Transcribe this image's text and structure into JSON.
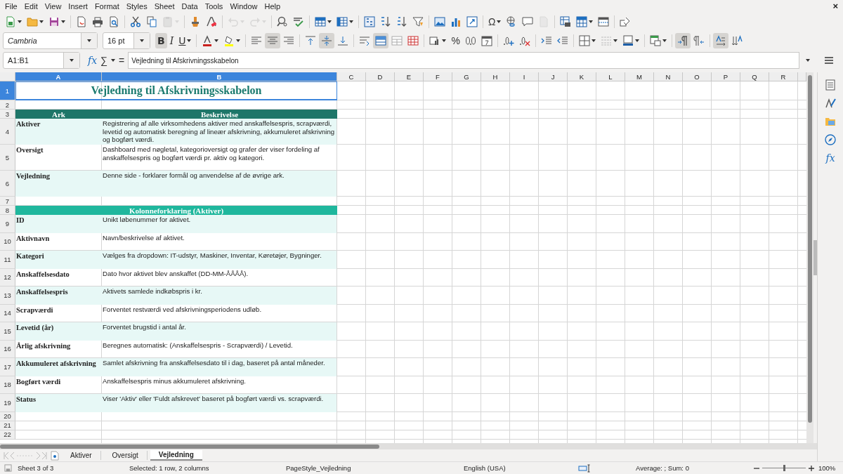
{
  "menu": [
    "File",
    "Edit",
    "View",
    "Insert",
    "Format",
    "Styles",
    "Sheet",
    "Data",
    "Tools",
    "Window",
    "Help"
  ],
  "close_label": "×",
  "standard_buttons": [
    {
      "kind": "new",
      "disabled": false
    },
    {
      "kind": "open",
      "disabled": false
    },
    {
      "kind": "save",
      "disabled": false
    },
    {
      "kind": "sep"
    },
    {
      "kind": "pdf",
      "disabled": false
    },
    {
      "kind": "print",
      "disabled": false
    },
    {
      "kind": "preview",
      "disabled": false
    },
    {
      "kind": "sep"
    },
    {
      "kind": "cut",
      "disabled": false
    },
    {
      "kind": "copy",
      "disabled": false
    },
    {
      "kind": "paste",
      "disabled": true
    },
    {
      "kind": "sep"
    },
    {
      "kind": "clone",
      "disabled": false
    },
    {
      "kind": "clear",
      "disabled": false
    },
    {
      "kind": "sep"
    },
    {
      "kind": "undo",
      "disabled": true
    },
    {
      "kind": "redo",
      "disabled": true
    },
    {
      "kind": "sep"
    },
    {
      "kind": "find",
      "disabled": false
    },
    {
      "kind": "spell",
      "disabled": false
    },
    {
      "kind": "sep"
    },
    {
      "kind": "row",
      "disabled": false
    },
    {
      "kind": "column",
      "disabled": false
    },
    {
      "kind": "sep"
    },
    {
      "kind": "sort",
      "disabled": false
    },
    {
      "kind": "sort_asc",
      "disabled": false
    },
    {
      "kind": "sort_desc",
      "disabled": false
    },
    {
      "kind": "filter",
      "disabled": false
    },
    {
      "kind": "sep"
    },
    {
      "kind": "image",
      "disabled": false
    },
    {
      "kind": "chart",
      "disabled": false
    },
    {
      "kind": "pivot",
      "disabled": false
    },
    {
      "kind": "sep"
    },
    {
      "kind": "special",
      "label": "Ω",
      "disabled": false
    },
    {
      "kind": "link",
      "disabled": false
    },
    {
      "kind": "comment",
      "disabled": false
    },
    {
      "kind": "headerfooter",
      "disabled": true
    },
    {
      "kind": "sep"
    },
    {
      "kind": "printarea",
      "disabled": false
    },
    {
      "kind": "freeze",
      "disabled": false
    },
    {
      "kind": "split",
      "disabled": false
    },
    {
      "kind": "sep"
    },
    {
      "kind": "draw",
      "disabled": false
    }
  ],
  "font_name": "Cambria",
  "font_size": "16 pt",
  "format_buttons": [
    {
      "kind": "bold",
      "label": "B",
      "selected": true
    },
    {
      "kind": "italic",
      "label": "I",
      "selected": false
    },
    {
      "kind": "underline",
      "label": "U",
      "selected": false
    },
    {
      "kind": "sep"
    },
    {
      "kind": "font_color",
      "selected": false
    },
    {
      "kind": "highlight",
      "selected": false
    },
    {
      "kind": "sep"
    },
    {
      "kind": "align_left",
      "selected": false
    },
    {
      "kind": "align_center",
      "selected": true
    },
    {
      "kind": "align_right",
      "selected": false
    },
    {
      "kind": "sep"
    },
    {
      "kind": "align_top",
      "selected": false
    },
    {
      "kind": "align_middle",
      "selected": true
    },
    {
      "kind": "align_bottom",
      "selected": false
    },
    {
      "kind": "sep"
    },
    {
      "kind": "wrap",
      "selected": false
    },
    {
      "kind": "merge_center",
      "selected": true
    },
    {
      "kind": "merge",
      "selected": false
    },
    {
      "kind": "unmerge",
      "selected": false
    },
    {
      "kind": "sep"
    },
    {
      "kind": "currency",
      "selected": false
    },
    {
      "kind": "percent",
      "label": "%",
      "selected": false
    },
    {
      "kind": "number",
      "selected": false
    },
    {
      "kind": "date",
      "selected": false
    },
    {
      "kind": "sep"
    },
    {
      "kind": "add_decimal",
      "selected": false
    },
    {
      "kind": "delete_decimal",
      "selected": false
    },
    {
      "kind": "sep"
    },
    {
      "kind": "indent_more",
      "selected": false
    },
    {
      "kind": "indent_less",
      "selected": false
    },
    {
      "kind": "sep"
    },
    {
      "kind": "borders",
      "selected": false
    },
    {
      "kind": "border_style",
      "selected": false
    },
    {
      "kind": "border_color",
      "selected": false
    },
    {
      "kind": "sep"
    },
    {
      "kind": "conditional",
      "selected": false
    },
    {
      "kind": "sep"
    },
    {
      "kind": "ltr",
      "selected": true
    },
    {
      "kind": "rtl",
      "selected": false
    },
    {
      "kind": "sep"
    },
    {
      "kind": "text_ltr",
      "selected": true
    },
    {
      "kind": "text_ttb",
      "selected": false
    }
  ],
  "formula_bar": {
    "name_box": "A1:B1",
    "wizard_label": "fx",
    "sum_label": "∑",
    "equals_label": "=",
    "content": "Vejledning til Afskrivningsskabelon"
  },
  "columns": [
    {
      "label": "A",
      "selected": true
    },
    {
      "label": "B",
      "selected": true
    },
    {
      "label": "C",
      "selected": false
    },
    {
      "label": "D",
      "selected": false
    },
    {
      "label": "E",
      "selected": false
    },
    {
      "label": "F",
      "selected": false
    },
    {
      "label": "G",
      "selected": false
    },
    {
      "label": "H",
      "selected": false
    },
    {
      "label": "I",
      "selected": false
    },
    {
      "label": "J",
      "selected": false
    },
    {
      "label": "K",
      "selected": false
    },
    {
      "label": "L",
      "selected": false
    },
    {
      "label": "M",
      "selected": false
    },
    {
      "label": "N",
      "selected": false
    },
    {
      "label": "O",
      "selected": false
    },
    {
      "label": "P",
      "selected": false
    },
    {
      "label": "Q",
      "selected": false
    },
    {
      "label": "R",
      "selected": false
    }
  ],
  "rows": [
    {
      "number": "1",
      "selected": true,
      "kind": "title",
      "cells": [
        "Vejledning til Afskrivningsskabelon"
      ]
    },
    {
      "number": "2",
      "selected": false,
      "kind": "empty"
    },
    {
      "number": "3",
      "selected": false,
      "kind": "header",
      "cells": [
        "Ark",
        "Beskrivelse"
      ]
    },
    {
      "number": "4",
      "selected": false,
      "kind": "sheet_entry",
      "shaded": true,
      "cells": [
        "Aktiver",
        "Registrering af alle virksomhedens aktiver med anskaffelsespris, scrapværdi, levetid og automatisk beregning af lineær afskrivning, akkumuleret afskrivning og bogført værdi."
      ]
    },
    {
      "number": "5",
      "selected": false,
      "kind": "sheet_entry",
      "shaded": false,
      "cells": [
        "Oversigt",
        "Dashboard med nøgletal, kategorioversigt og grafer der viser fordeling af anskaffelsespris og bogført værdi pr. aktiv og kategori."
      ]
    },
    {
      "number": "6",
      "selected": false,
      "kind": "sheet_entry",
      "shaded": true,
      "cells": [
        "Vejledning",
        "Denne side - forklarer formål og anvendelse af de øvrige ark."
      ]
    },
    {
      "number": "7",
      "selected": false,
      "kind": "empty"
    },
    {
      "number": "8",
      "selected": false,
      "kind": "section",
      "cells": [
        "Kolonneforklaring (Aktiver)"
      ]
    },
    {
      "number": "9",
      "selected": false,
      "kind": "field",
      "shaded": true,
      "cells": [
        "ID",
        "Unikt løbenummer for aktivet."
      ]
    },
    {
      "number": "10",
      "selected": false,
      "kind": "field",
      "shaded": false,
      "cells": [
        "Aktivnavn",
        "Navn/beskrivelse af aktivet."
      ]
    },
    {
      "number": "11",
      "selected": false,
      "kind": "field",
      "shaded": true,
      "cells": [
        "Kategori",
        "Vælges fra dropdown: IT-udstyr, Maskiner, Inventar, Køretøjer, Bygninger."
      ]
    },
    {
      "number": "12",
      "selected": false,
      "kind": "field",
      "shaded": false,
      "cells": [
        "Anskaffelsesdato",
        "Dato hvor aktivet blev anskaffet (DD-MM-ÅÅÅÅ)."
      ]
    },
    {
      "number": "13",
      "selected": false,
      "kind": "field",
      "shaded": true,
      "cells": [
        "Anskaffelsespris",
        "Aktivets samlede indkøbspris i kr."
      ]
    },
    {
      "number": "14",
      "selected": false,
      "kind": "field",
      "shaded": false,
      "cells": [
        "Scrapværdi",
        "Forventet restværdi ved afskrivningsperiodens udløb."
      ]
    },
    {
      "number": "15",
      "selected": false,
      "kind": "field",
      "shaded": true,
      "cells": [
        "Levetid (år)",
        "Forventet brugstid i antal år."
      ]
    },
    {
      "number": "16",
      "selected": false,
      "kind": "field",
      "shaded": false,
      "cells": [
        "Årlig afskrivning",
        "Beregnes automatisk: (Anskaffelsespris - Scrapværdi) / Levetid."
      ]
    },
    {
      "number": "17",
      "selected": false,
      "kind": "field",
      "shaded": true,
      "cells": [
        "Akkumuleret afskrivning",
        "Samlet afskrivning fra anskaffelsesdato til i dag, baseret på antal måneder."
      ]
    },
    {
      "number": "18",
      "selected": false,
      "kind": "field",
      "shaded": false,
      "cells": [
        "Bogført værdi",
        "Anskaffelsespris minus akkumuleret afskrivning."
      ]
    },
    {
      "number": "19",
      "selected": false,
      "kind": "field",
      "shaded": true,
      "cells": [
        "Status",
        "Viser 'Aktiv' eller 'Fuldt afskrevet' baseret på bogført værdi vs. scrapværdi."
      ]
    },
    {
      "number": "20",
      "selected": false,
      "kind": "empty"
    },
    {
      "number": "21",
      "selected": false,
      "kind": "empty"
    },
    {
      "number": "22",
      "selected": false,
      "kind": "empty"
    }
  ],
  "sheet_tabs": [
    {
      "label": "Aktiver",
      "selected": false
    },
    {
      "label": "Oversigt",
      "selected": false
    },
    {
      "label": "Vejledning",
      "selected": true
    }
  ],
  "sidebar_label": "fx",
  "status_bar": {
    "sheet": "Sheet 3 of 3",
    "selection": "Selected: 1 row, 2 columns",
    "page_style": "PageStyle_Vejledning",
    "language": "English (USA)",
    "summary": "Average: ; Sum: 0",
    "zoom": {
      "level": 0.5,
      "reading": "100%"
    }
  }
}
